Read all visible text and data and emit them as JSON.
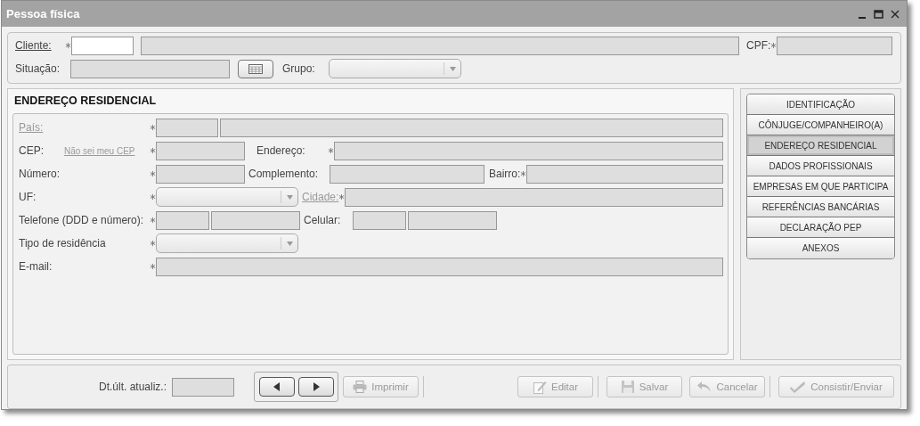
{
  "window": {
    "title": "Pessoa física"
  },
  "client": {
    "cliente": {
      "label": "Cliente:",
      "required": true
    },
    "code_disabled": false,
    "name_disabled": true,
    "cpf": {
      "label": "CPF:",
      "required": true
    },
    "situacao": {
      "label": "Situação:"
    },
    "grupo": {
      "label": "Grupo:"
    }
  },
  "address": {
    "title": "ENDEREÇO RESIDENCIAL",
    "pais": {
      "label": "País:",
      "link": true,
      "required": true
    },
    "cep": {
      "label": "CEP:",
      "help_link": "Não sei meu CEP",
      "required": true
    },
    "endereco": {
      "label": "Endereço:",
      "required": true
    },
    "numero": {
      "label": "Número:",
      "required": true
    },
    "complemento": {
      "label": "Complemento:",
      "required": false
    },
    "bairro": {
      "label": "Bairro:",
      "required": true
    },
    "uf": {
      "label": "UF:",
      "required": true
    },
    "cidade": {
      "label": "Cidade:",
      "link": true,
      "required": true
    },
    "telefone": {
      "label": "Telefone (DDD e número):",
      "required": true
    },
    "celular": {
      "label": "Celular:",
      "required": false
    },
    "tipo_residencia": {
      "label": "Tipo de residência",
      "required": true
    },
    "email": {
      "label": "E-mail:",
      "required": true
    }
  },
  "sections": [
    {
      "label": "IDENTIFICAÇÃO",
      "selected": false
    },
    {
      "label": "CÔNJUGE/COMPANHEIRO(A)",
      "selected": false
    },
    {
      "label": "ENDEREÇO RESIDENCIAL",
      "selected": true
    },
    {
      "label": "DADOS PROFISSIONAIS",
      "selected": false
    },
    {
      "label": "EMPRESAS EM QUE PARTICIPA",
      "selected": false
    },
    {
      "label": "REFERÊNCIAS BANCÁRIAS",
      "selected": false
    },
    {
      "label": "DECLARAÇÃO PEP",
      "selected": false
    },
    {
      "label": "ANEXOS",
      "selected": false
    }
  ],
  "footer": {
    "updated_label": "Dt.últ. atualiz.:",
    "buttons": [
      {
        "kind": "print",
        "label": "Imprimir",
        "disabled": true
      },
      {
        "kind": "edit",
        "label": "Editar",
        "disabled": true
      },
      {
        "kind": "save",
        "label": "Salvar",
        "disabled": true
      },
      {
        "kind": "cancel",
        "label": "Cancelar",
        "disabled": true
      },
      {
        "kind": "submit",
        "label": "Consistir/Enviar",
        "disabled": true
      }
    ]
  }
}
